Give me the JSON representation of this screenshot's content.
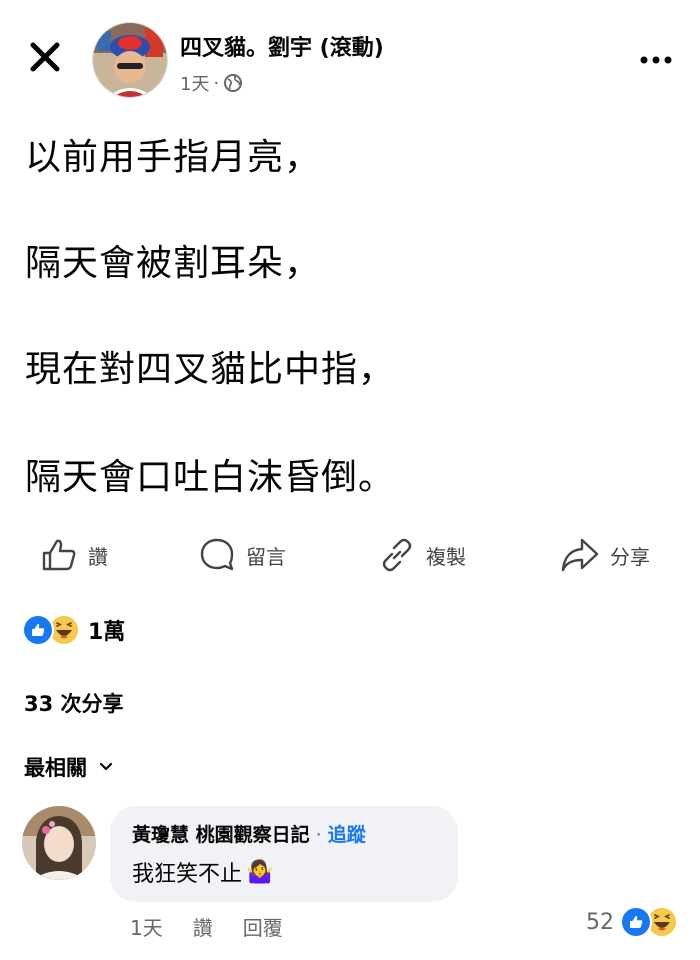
{
  "header": {
    "author": "四叉貓。劉宇 (滾動)",
    "time": "1天",
    "separator": "·",
    "privacy_icon": "globe-icon",
    "close_icon": "close-icon",
    "more_icon": "more-options-icon"
  },
  "post": {
    "lines": [
      "以前用手指月亮，",
      "隔天會被割耳朵，",
      "現在對四叉貓比中指，",
      "隔天會口吐白沫昏倒。"
    ]
  },
  "actions": {
    "like": "讚",
    "comment": "留言",
    "copy": "複製",
    "share": "分享"
  },
  "reactions": {
    "count": "1萬",
    "types": [
      "like",
      "haha"
    ]
  },
  "shares": "33 次分享",
  "sort_label": "最相關",
  "comment": {
    "name": "黃瓊慧 桃園觀察日記",
    "dot": " · ",
    "follow": "追蹤",
    "text": "我狂笑不止",
    "emoji": "🤷‍♀️",
    "time": "1天",
    "like": "讚",
    "reply": "回覆",
    "reaction_count": "52"
  },
  "colors": {
    "accent": "#1877f2",
    "secondary_text": "#65676b",
    "bubble": "#f0f2f5"
  }
}
